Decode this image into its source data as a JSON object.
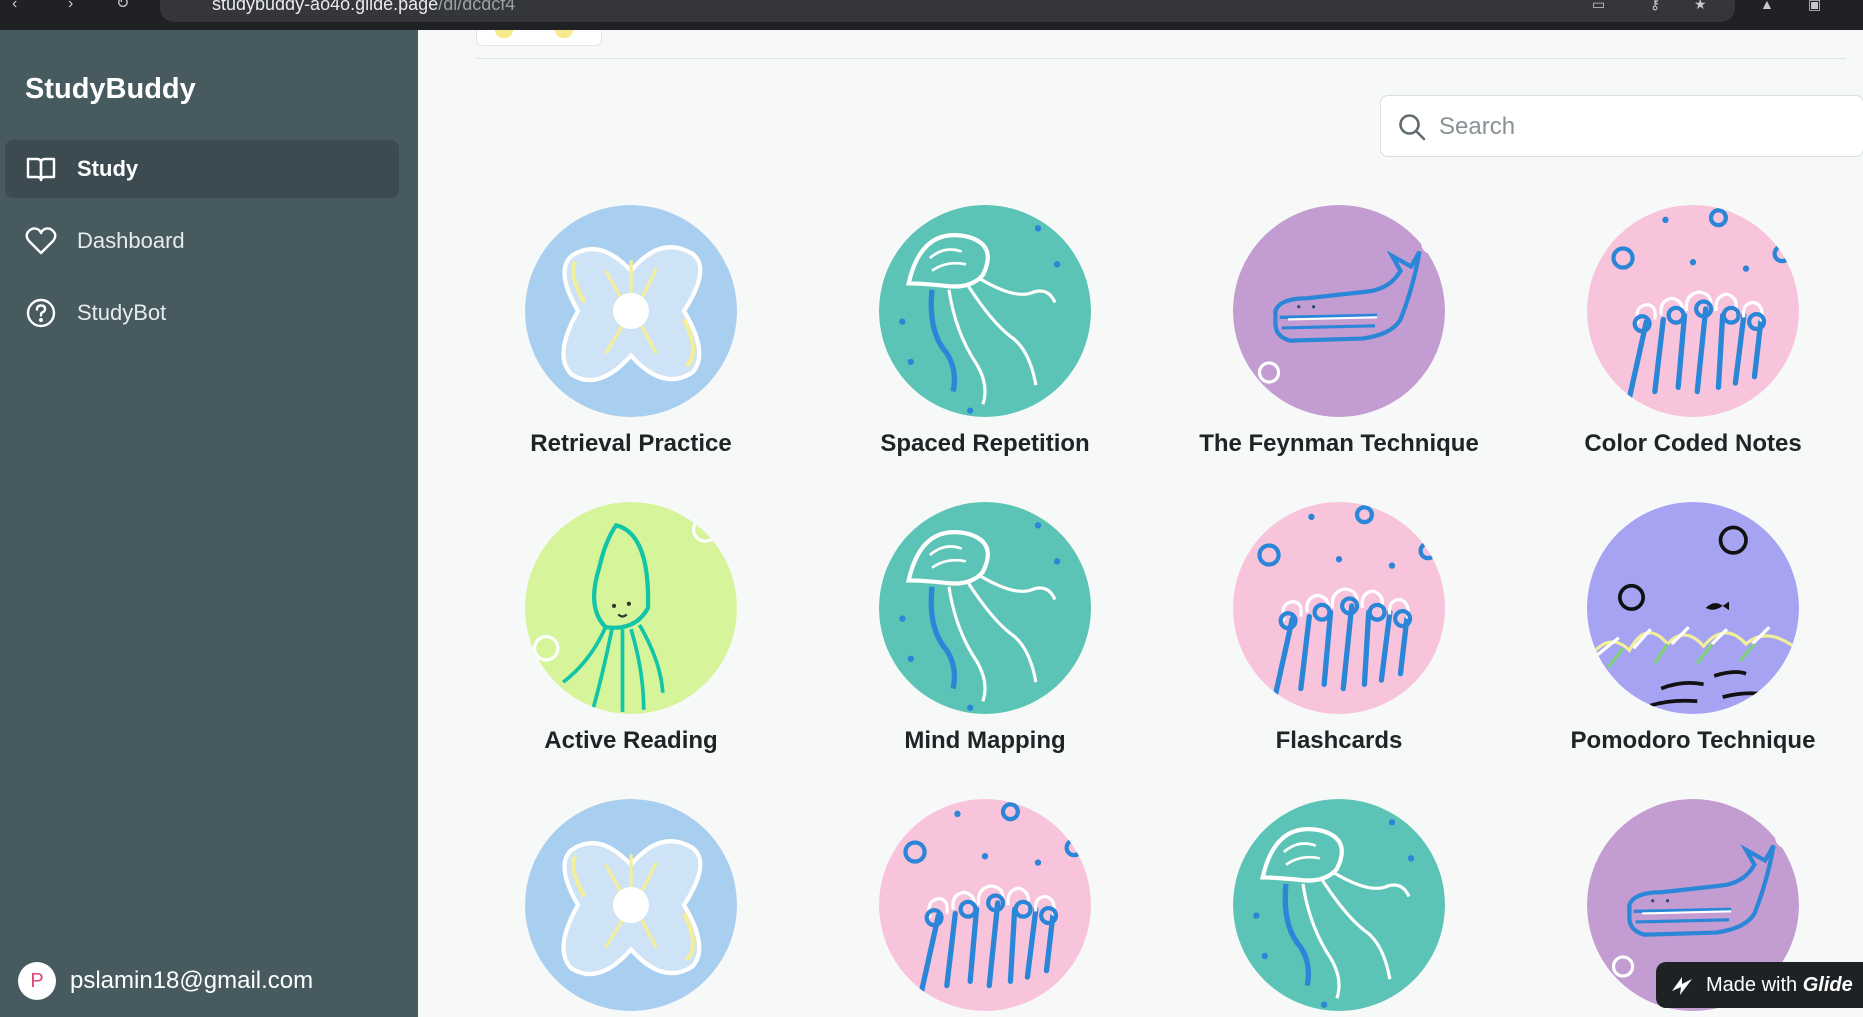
{
  "browser": {
    "url_main": "studybuddy-ao4o.glide.page",
    "url_path": "/dl/dcdcf4"
  },
  "sidebar": {
    "app_title": "StudyBuddy",
    "items": [
      {
        "label": "Study",
        "icon": "book-icon",
        "active": true
      },
      {
        "label": "Dashboard",
        "icon": "heart-icon",
        "active": false
      },
      {
        "label": "StudyBot",
        "icon": "help-circle-icon",
        "active": false
      }
    ],
    "user": {
      "avatar_letter": "P",
      "email": "pslamin18@gmail.com"
    }
  },
  "search": {
    "placeholder": "Search",
    "value": ""
  },
  "cards": [
    {
      "label": "Retrieval Practice",
      "image": "shell-icon",
      "bg": "#a8cff0"
    },
    {
      "label": "Spaced Repetition",
      "image": "jellyfish-icon",
      "bg": "#5cc4b6"
    },
    {
      "label": "The Feynman Technique",
      "image": "whale-icon",
      "bg": "#c39cd2"
    },
    {
      "label": "Color Coded Notes",
      "image": "coral-icon",
      "bg": "#f8c4dc"
    },
    {
      "label": "Active Reading",
      "image": "squid-icon",
      "bg": "#d6f59a"
    },
    {
      "label": "Mind Mapping",
      "image": "jellyfish-icon",
      "bg": "#5cc4b6"
    },
    {
      "label": "Flashcards",
      "image": "coral-icon",
      "bg": "#f8c4dc"
    },
    {
      "label": "Pomodoro Technique",
      "image": "seafloor-fish-icon",
      "bg": "#a6a4f2"
    },
    {
      "label": "",
      "image": "shell-icon",
      "bg": "#a8cff0"
    },
    {
      "label": "",
      "image": "coral-icon",
      "bg": "#f8c4dc"
    },
    {
      "label": "",
      "image": "jellyfish-icon",
      "bg": "#5cc4b6"
    },
    {
      "label": "",
      "image": "whale-icon",
      "bg": "#c39cd2"
    }
  ],
  "badge": {
    "prefix": "Made with",
    "brand": "Glide"
  }
}
